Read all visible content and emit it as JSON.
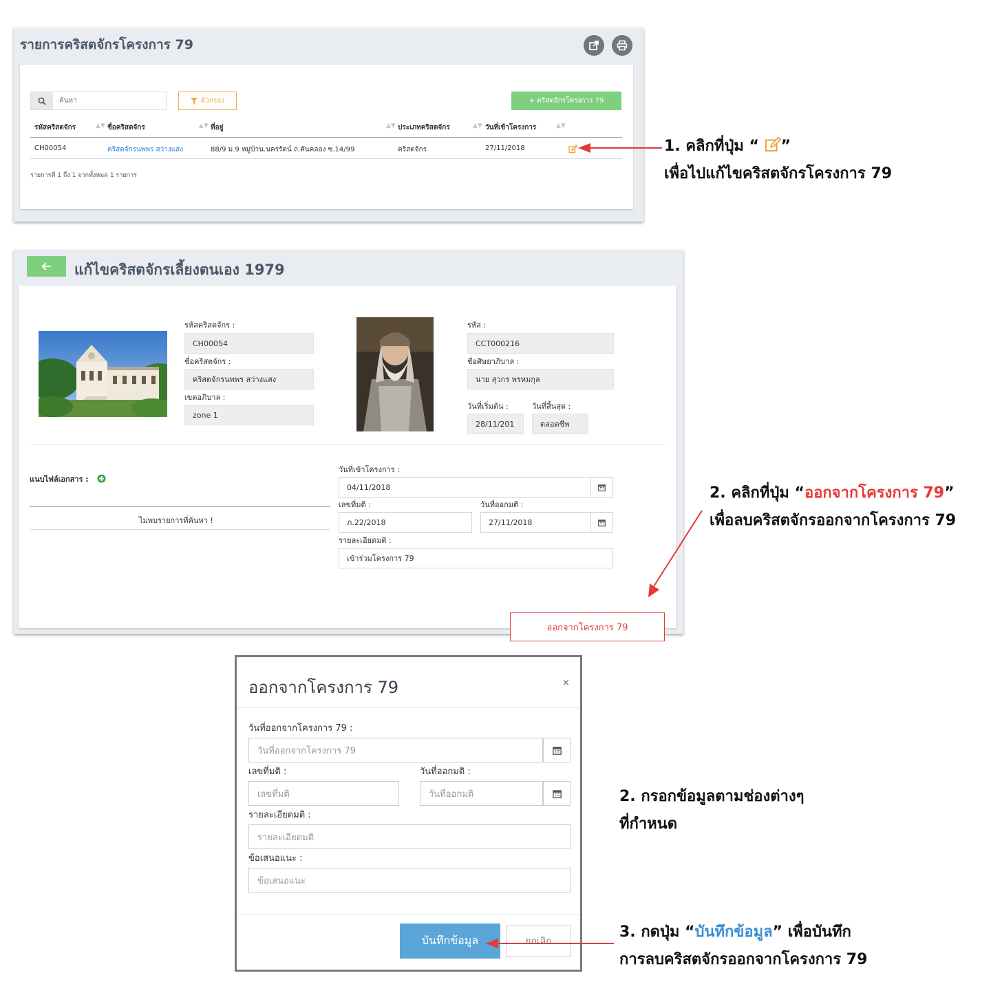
{
  "panel1": {
    "title": "รายการคริสตจักรโครงการ 79",
    "search_placeholder": "ค้นหา",
    "filter_label": "ตัวกรอง",
    "add_label": "+ คริสตจักรโครงการ 79",
    "columns": [
      "รหัสคริสตจักร",
      "ชื่อคริสตจักร",
      "ที่อยู่",
      "ประเภทคริสตจักร",
      "วันที่เข้าโครงการ"
    ],
    "row": {
      "code": "CH00054",
      "name": "คริสตจักรนพพร สว่างแสง",
      "address": "88/9 ม.9 หมู่บ้าน.นครรัตน์ ถ.คันคลอง ซ.14/99",
      "type": "คริสตจักร",
      "join_date": "27/11/2018"
    },
    "footer": "รายการที่ 1 ถึง 1 จากทั้งหมด 1 รายการ"
  },
  "panel2": {
    "title": "แก้ไขคริสตจักรเลี้ยงตนเอง 1979",
    "church_code_label": "รหัสคริสตจักร :",
    "church_code": "CH00054",
    "church_name_label": "ชื่อคริสตจักร :",
    "church_name": "คริสตจักรนพพร สว่างแสง",
    "district_label": "เขตอภิบาล :",
    "district": "zone 1",
    "code_label": "รหัส :",
    "code": "CCT000216",
    "pastor_label": "ชื่อศิษยาภิบาล :",
    "pastor": "นาย สุวกร พรหมกุล",
    "start_label": "วันที่เริ่มต้น :",
    "start": "28/11/201",
    "end_label": "วันที่สิ้นสุด :",
    "end": "ตลอดชีพ",
    "attach_label": "แนบไฟล์เอกสาร :",
    "no_result": "ไม่พบรายการที่ค้นหา !",
    "join_date_label": "วันที่เข้าโครงการ :",
    "join_date": "04/11/2018",
    "resolution_no_label": "เลขที่มติ :",
    "resolution_no": "ภ.22/2018",
    "resolution_date_label": "วันที่ออกมติ :",
    "resolution_date": "27/11/2018",
    "detail_label": "รายละเอียดมติ :",
    "detail": "เข้าร่วมโครงการ 79",
    "leave_button": "ออกจากโครงการ 79"
  },
  "modal": {
    "title": "ออกจากโครงการ 79",
    "close": "×",
    "leave_date_label": "วันที่ออกจากโครงการ 79 :",
    "leave_date_placeholder": "วันที่ออกจากโครงการ 79",
    "resolution_no_label": "เลขที่มติ :",
    "resolution_no_placeholder": "เลขที่มติ",
    "resolution_date_label": "วันที่ออกมติ :",
    "resolution_date_placeholder": "วันที่ออกมติ",
    "detail_label": "รายละเอียดมติ :",
    "detail_placeholder": "รายละเอียดมติ",
    "suggestion_label": "ข้อเสนอแนะ :",
    "suggestion_placeholder": "ข้อเสนอแนะ",
    "save_button": "บันทึกข้อมูล",
    "cancel_button": "ยกเลิก"
  },
  "annotations": {
    "step1_prefix": "1. คลิกที่ปุ่ม “ ",
    "step1_suffix": "”",
    "step1_line2": "เพื่อไปแก้ไขคริสตจักรโครงการ 79",
    "step2_prefix": "2. คลิกที่ปุ่ม “",
    "step2_highlight": "ออกจากโครงการ 79",
    "step2_suffix": "”",
    "step2_line2": "เพื่อลบคริสตจักรออกจากโครงการ 79",
    "step2b_line1": "2. กรอกข้อมูลตามช่องต่างๆ",
    "step2b_line2": "ที่กำหนด",
    "step3_prefix": "3. กดปุ่ม “",
    "step3_highlight": "บันทึกข้อมูล",
    "step3_suffix": "” เพื่อบันทึก",
    "step3_line2": "การลบคริสตจักรออกจากโครงการ 79"
  },
  "colors": {
    "accent_green": "#7ed07e",
    "link_blue": "#2b7fd3",
    "danger_red": "#e53935",
    "save_blue": "#5aa6d8",
    "edit_orange": "#f0a030"
  }
}
